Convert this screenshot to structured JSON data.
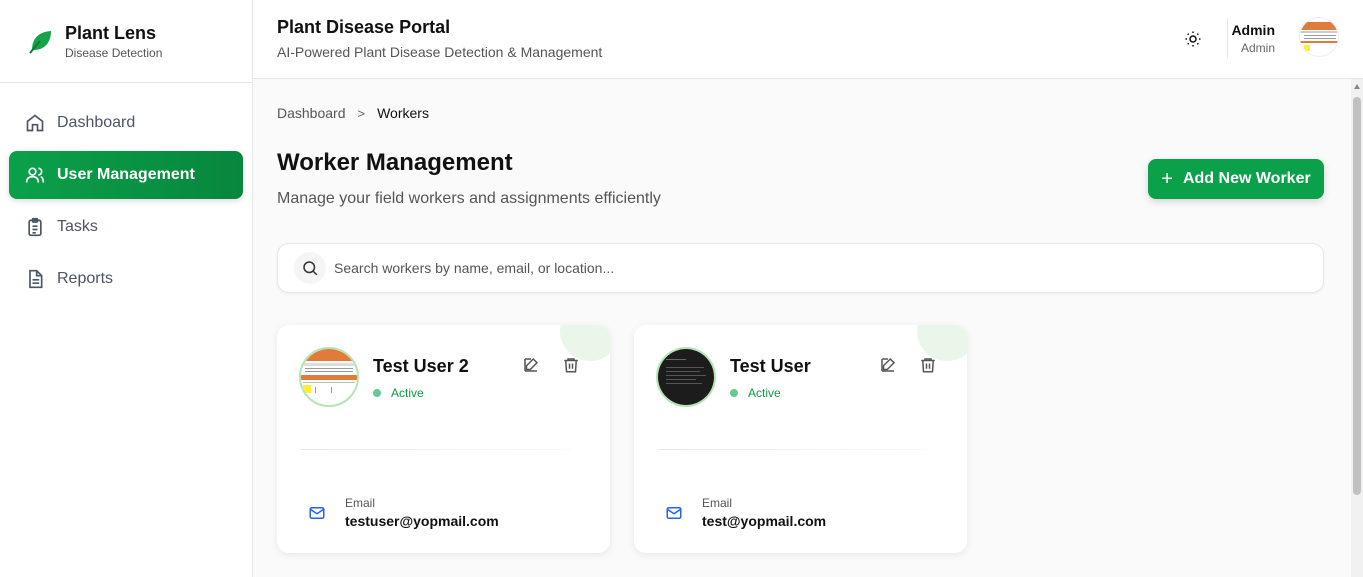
{
  "brand": {
    "title": "Plant Lens",
    "subtitle": "Disease Detection"
  },
  "sidebar": {
    "items": [
      {
        "label": "Dashboard",
        "icon": "home-icon"
      },
      {
        "label": "User Management",
        "icon": "users-icon",
        "active": true
      },
      {
        "label": "Tasks",
        "icon": "clipboard-icon"
      },
      {
        "label": "Reports",
        "icon": "file-text-icon"
      }
    ]
  },
  "header": {
    "title": "Plant Disease Portal",
    "subtitle": "AI-Powered Plant Disease Detection & Management",
    "user_name": "Admin",
    "user_role": "Admin"
  },
  "breadcrumb": {
    "root": "Dashboard",
    "separator": ">",
    "current": "Workers"
  },
  "page": {
    "title": "Worker Management",
    "subtitle": "Manage your field workers and assignments efficiently",
    "add_button": "Add New Worker"
  },
  "search": {
    "placeholder": "Search workers by name, email, or location..."
  },
  "workers": [
    {
      "name": "Test User 2",
      "status": "Active",
      "email_label": "Email",
      "email": "testuser@yopmail.com"
    },
    {
      "name": "Test User",
      "status": "Active",
      "email_label": "Email",
      "email": "test@yopmail.com"
    }
  ],
  "colors": {
    "accent": "#0aa14a",
    "status_active": "#0a9a47",
    "email_icon": "#2563eb"
  }
}
